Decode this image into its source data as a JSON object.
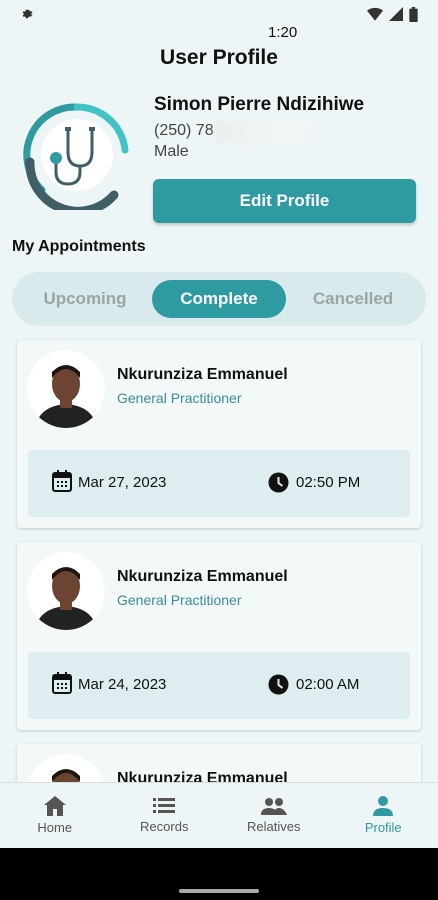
{
  "status_bar": {
    "time": "1:20"
  },
  "header": {
    "title": "User Profile"
  },
  "profile": {
    "name": "Simon Pierre Ndizihiwe",
    "phone": "(250) 78",
    "gender": "Male",
    "edit_label": "Edit Profile"
  },
  "appointments": {
    "title": "My Appointments",
    "tabs": [
      {
        "label": "Upcoming",
        "active": false
      },
      {
        "label": "Complete",
        "active": true
      },
      {
        "label": "Cancelled",
        "active": false
      }
    ],
    "items": [
      {
        "doctor": "Nkurunziza Emmanuel",
        "specialty": "General Practitioner",
        "date": "Mar 27, 2023",
        "time": "02:50 PM"
      },
      {
        "doctor": "Nkurunziza Emmanuel",
        "specialty": "General Practitioner",
        "date": "Mar 24, 2023",
        "time": "02:00 AM"
      },
      {
        "doctor": "Nkurunziza Emmanuel"
      }
    ]
  },
  "nav": {
    "items": [
      {
        "label": "Home",
        "icon": "home-icon"
      },
      {
        "label": "Records",
        "icon": "list-icon"
      },
      {
        "label": "Relatives",
        "icon": "people-icon"
      },
      {
        "label": "Profile",
        "icon": "person-icon"
      }
    ],
    "active": "Profile"
  },
  "colors": {
    "accent": "#2e9aa1",
    "background": "#eef5f6"
  }
}
